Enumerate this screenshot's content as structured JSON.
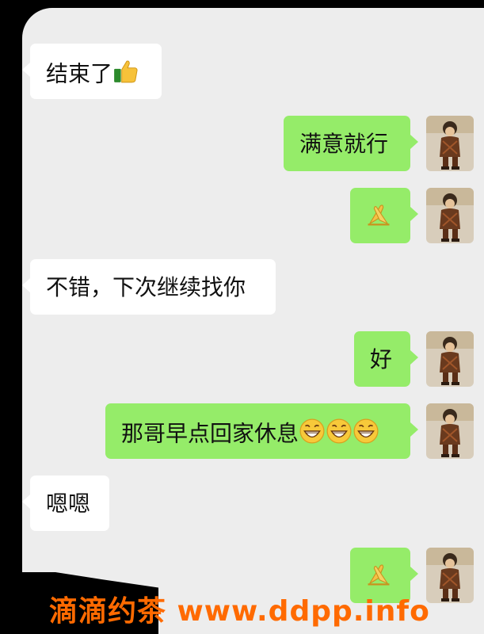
{
  "messages": [
    {
      "side": "in",
      "text": "结束了",
      "emoji": "thumbs-up"
    },
    {
      "side": "out",
      "text": "满意就行"
    },
    {
      "side": "out",
      "text": "",
      "emoji": "folded-hands"
    },
    {
      "side": "in",
      "text": "不错，下次继续找你"
    },
    {
      "side": "out",
      "text": "好"
    },
    {
      "side": "out",
      "text": "那哥早点回家休息",
      "emoji": "grinning-squinting x3"
    },
    {
      "side": "in",
      "text": "嗯嗯"
    },
    {
      "side": "out",
      "text": "",
      "emoji": "folded-hands"
    }
  ],
  "watermark": "滴滴约茶 www.ddpp.info",
  "colors": {
    "incoming": "#ffffff",
    "outgoing": "#95ec69",
    "background": "#ededed",
    "watermark": "#ff6a00"
  }
}
